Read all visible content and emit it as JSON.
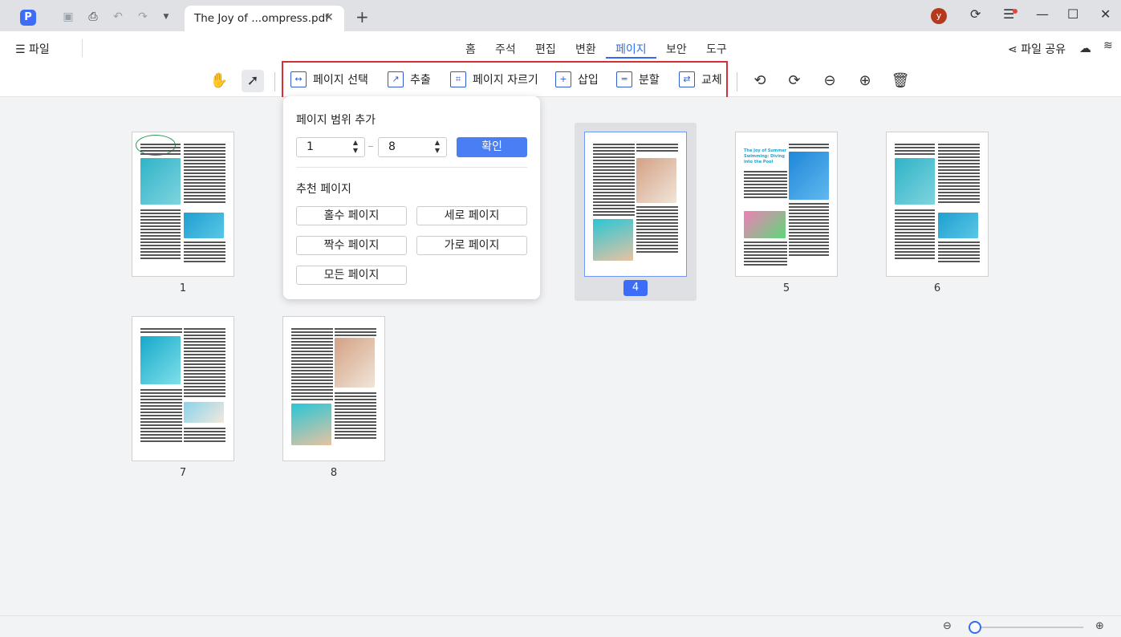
{
  "window": {
    "tab_title": "The Joy of ...ompress.pdf",
    "avatar_letter": "y"
  },
  "menubar": {
    "file": "☰ 파일",
    "tabs": [
      "홈",
      "주석",
      "편집",
      "변환",
      "페이지",
      "보안",
      "도구"
    ],
    "active_tab": "페이지",
    "share": "파일 공유"
  },
  "toolbar": {
    "select_page": "페이지 선택",
    "extract": "추출",
    "crop": "페이지 자르기",
    "insert": "삽입",
    "split": "분할",
    "replace": "교체"
  },
  "popup": {
    "title": "페이지 범위 추가",
    "range_from": "1",
    "range_to": "8",
    "ok": "확인",
    "recommended_title": "추천 페이지",
    "odd": "홀수 페이지",
    "portrait": "세로 페이지",
    "even": "짝수 페이지",
    "landscape": "가로 페이지",
    "all": "모든 페이지"
  },
  "pages": {
    "p1": "1",
    "p4": "4",
    "p5": "5",
    "p6": "6",
    "p7": "7",
    "p8": "8",
    "page5_heading": "The Joy of Summer Swimming: Diving into the Pool",
    "selected": "4"
  },
  "colors": {
    "accent": "#2f6cf5",
    "highlight_border": "#d42f37"
  }
}
